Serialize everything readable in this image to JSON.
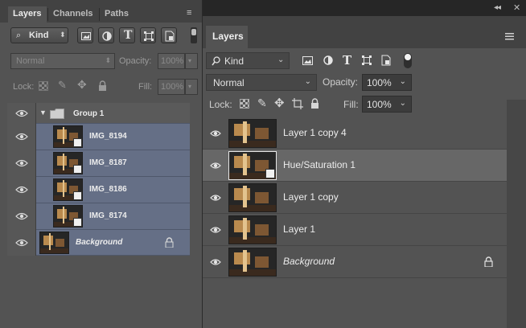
{
  "left_panel": {
    "tabs": [
      {
        "label": "Layers"
      },
      {
        "label": "Channels"
      },
      {
        "label": "Paths"
      }
    ],
    "filter": {
      "kind_label": "Kind"
    },
    "blend_mode": "Normal",
    "opacity_label": "Opacity:",
    "opacity_value": "100%",
    "lock_label": "Lock:",
    "fill_label": "Fill:",
    "fill_value": "100%",
    "group": {
      "name": "Group 1"
    },
    "layers": [
      {
        "name": "IMG_8194"
      },
      {
        "name": "IMG_8187"
      },
      {
        "name": "IMG_8186"
      },
      {
        "name": "IMG_8174"
      },
      {
        "name": "Background"
      }
    ]
  },
  "right_panel": {
    "tab_label": "Layers",
    "filter": {
      "kind_label": "Kind"
    },
    "blend_mode": "Normal",
    "opacity_label": "Opacity:",
    "opacity_value": "100%",
    "lock_label": "Lock:",
    "fill_label": "Fill:",
    "fill_value": "100%",
    "layers": [
      {
        "name": "Layer 1 copy 4"
      },
      {
        "name": "Hue/Saturation 1"
      },
      {
        "name": "Layer 1 copy"
      },
      {
        "name": "Layer 1"
      },
      {
        "name": "Background"
      }
    ]
  },
  "colors": {
    "panel_bg": "#535353",
    "selected_row_old": "#656f86",
    "selected_row_cc": "#676767"
  }
}
